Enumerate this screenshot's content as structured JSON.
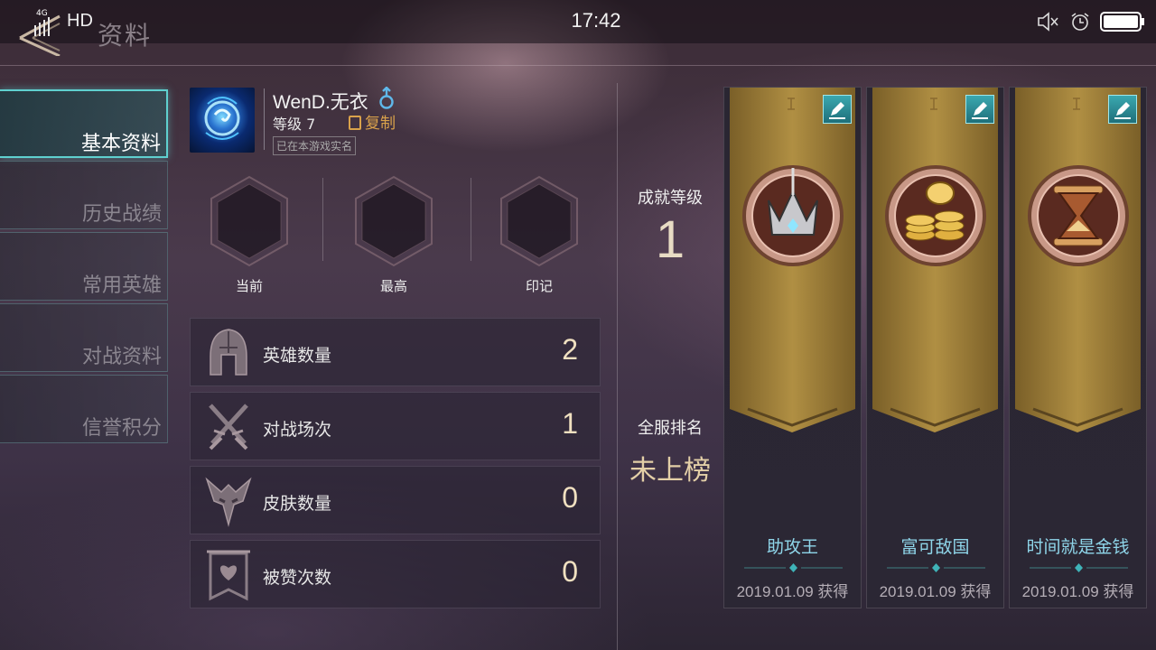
{
  "status_bar": {
    "time": "17:42",
    "network": "4G",
    "hd": "HD"
  },
  "header": {
    "title": "资料"
  },
  "sidebar": {
    "items": [
      {
        "label": "基本资料",
        "active": true
      },
      {
        "label": "历史战绩",
        "active": false
      },
      {
        "label": "常用英雄",
        "active": false
      },
      {
        "label": "对战资料",
        "active": false
      },
      {
        "label": "信誉积分",
        "active": false
      }
    ]
  },
  "profile": {
    "name": "WenD.无衣",
    "level": "等级 7",
    "copy_label": "复制",
    "verified": "已在本游戏实名",
    "gender": "male"
  },
  "ranks": [
    {
      "label": "当前"
    },
    {
      "label": "最高"
    },
    {
      "label": "印记"
    }
  ],
  "stats": [
    {
      "icon": "helmet-icon",
      "label": "英雄数量",
      "value": "2"
    },
    {
      "icon": "crossed-swords-icon",
      "label": "对战场次",
      "value": "1"
    },
    {
      "icon": "dragon-mask-icon",
      "label": "皮肤数量",
      "value": "0"
    },
    {
      "icon": "heart-banner-icon",
      "label": "被赞次数",
      "value": "0"
    }
  ],
  "achievement": {
    "level_label": "成就等级",
    "level_value": "1",
    "rank_label": "全服排名",
    "rank_value": "未上榜"
  },
  "cards": [
    {
      "name": "助攻王",
      "date": "2019.01.09 获得",
      "medal": "crown-medal-icon"
    },
    {
      "name": "富可敌国",
      "date": "2019.01.09 获得",
      "medal": "coins-medal-icon"
    },
    {
      "name": "时间就是金钱",
      "date": "2019.01.09 获得",
      "medal": "hourglass-medal-icon"
    }
  ],
  "colors": {
    "accent_teal": "#5fd0cf",
    "gold": "#d9a24b",
    "banner_gold": "#a8873a",
    "achievement_name": "#8fd6ea"
  }
}
